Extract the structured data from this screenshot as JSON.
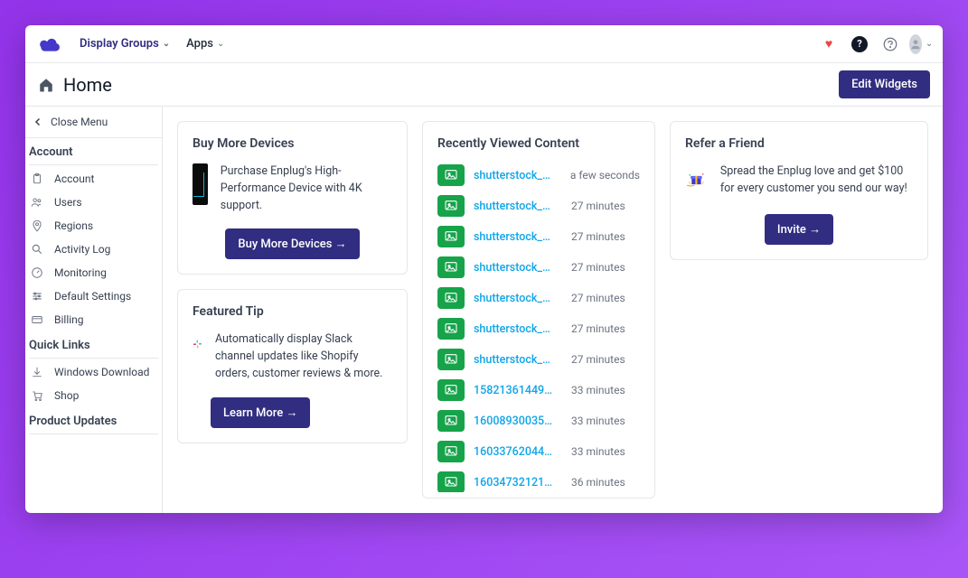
{
  "nav": {
    "display_groups": "Display Groups",
    "apps": "Apps"
  },
  "titlebar": {
    "title": "Home",
    "edit_widgets": "Edit Widgets"
  },
  "sidebar": {
    "close_menu": "Close Menu",
    "section_account": "Account",
    "account_items": [
      {
        "icon": "clipboard",
        "label": "Account"
      },
      {
        "icon": "users",
        "label": "Users"
      },
      {
        "icon": "pin",
        "label": "Regions"
      },
      {
        "icon": "search",
        "label": "Activity Log"
      },
      {
        "icon": "gauge",
        "label": "Monitoring"
      },
      {
        "icon": "sliders",
        "label": "Default Settings"
      },
      {
        "icon": "card",
        "label": "Billing"
      }
    ],
    "section_quicklinks": "Quick Links",
    "quicklinks": [
      {
        "icon": "download",
        "label": "Windows Download"
      },
      {
        "icon": "cart",
        "label": "Shop"
      }
    ],
    "section_product": "Product Updates"
  },
  "buy_devices": {
    "title": "Buy More Devices",
    "desc": "Purchase Enplug's High-Performance Device with 4K support.",
    "cta": "Buy More Devices →"
  },
  "featured_tip": {
    "title": "Featured Tip",
    "desc": "Automatically display Slack channel updates like Shopify orders, customer reviews & more.",
    "cta": "Learn More →"
  },
  "recent": {
    "title": "Recently Viewed Content",
    "items": [
      {
        "name": "shutterstock_…",
        "time": "a few seconds"
      },
      {
        "name": "shutterstock_…",
        "time": "27 minutes"
      },
      {
        "name": "shutterstock_…",
        "time": "27 minutes"
      },
      {
        "name": "shutterstock_…",
        "time": "27 minutes"
      },
      {
        "name": "shutterstock_…",
        "time": "27 minutes"
      },
      {
        "name": "shutterstock_…",
        "time": "27 minutes"
      },
      {
        "name": "shutterstock_…",
        "time": "27 minutes"
      },
      {
        "name": "15821361449…",
        "time": "33 minutes"
      },
      {
        "name": "16008930035…",
        "time": "33 minutes"
      },
      {
        "name": "16033762044…",
        "time": "33 minutes"
      },
      {
        "name": "16034732121…",
        "time": "36 minutes"
      }
    ]
  },
  "refer": {
    "title": "Refer a Friend",
    "desc": "Spread the Enplug love and get $100 for every customer you send our way!",
    "cta": "Invite →"
  }
}
